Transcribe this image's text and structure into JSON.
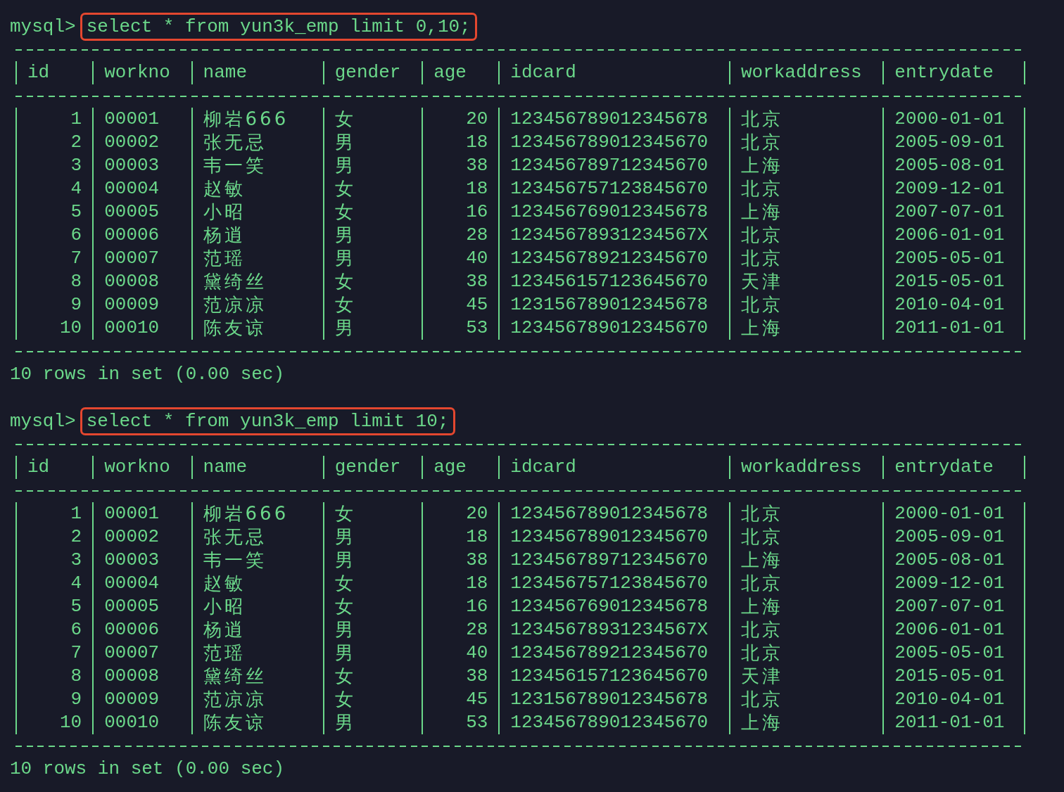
{
  "queries": [
    {
      "prompt": "mysql>",
      "command": "select * from yun3k_emp limit 0,10;",
      "highlighted": true,
      "columns": [
        "id",
        "workno",
        "name",
        "gender",
        "age",
        "idcard",
        "workaddress",
        "entrydate"
      ],
      "rows": [
        [
          "1",
          "00001",
          "柳岩666",
          "女",
          "20",
          "123456789012345678",
          "北京",
          "2000-01-01"
        ],
        [
          "2",
          "00002",
          "张无忌",
          "男",
          "18",
          "123456789012345670",
          "北京",
          "2005-09-01"
        ],
        [
          "3",
          "00003",
          "韦一笑",
          "男",
          "38",
          "123456789712345670",
          "上海",
          "2005-08-01"
        ],
        [
          "4",
          "00004",
          "赵敏",
          "女",
          "18",
          "123456757123845670",
          "北京",
          "2009-12-01"
        ],
        [
          "5",
          "00005",
          "小昭",
          "女",
          "16",
          "123456769012345678",
          "上海",
          "2007-07-01"
        ],
        [
          "6",
          "00006",
          "杨逍",
          "男",
          "28",
          "12345678931234567X",
          "北京",
          "2006-01-01"
        ],
        [
          "7",
          "00007",
          "范瑶",
          "男",
          "40",
          "123456789212345670",
          "北京",
          "2005-05-01"
        ],
        [
          "8",
          "00008",
          "黛绮丝",
          "女",
          "38",
          "123456157123645670",
          "天津",
          "2015-05-01"
        ],
        [
          "9",
          "00009",
          "范凉凉",
          "女",
          "45",
          "123156789012345678",
          "北京",
          "2010-04-01"
        ],
        [
          "10",
          "00010",
          "陈友谅",
          "男",
          "53",
          "123456789012345670",
          "上海",
          "2011-01-01"
        ]
      ],
      "summary": "10 rows in set (0.00 sec)"
    },
    {
      "prompt": "mysql>",
      "command": "select * from yun3k_emp limit 10;",
      "highlighted": true,
      "columns": [
        "id",
        "workno",
        "name",
        "gender",
        "age",
        "idcard",
        "workaddress",
        "entrydate"
      ],
      "rows": [
        [
          "1",
          "00001",
          "柳岩666",
          "女",
          "20",
          "123456789012345678",
          "北京",
          "2000-01-01"
        ],
        [
          "2",
          "00002",
          "张无忌",
          "男",
          "18",
          "123456789012345670",
          "北京",
          "2005-09-01"
        ],
        [
          "3",
          "00003",
          "韦一笑",
          "男",
          "38",
          "123456789712345670",
          "上海",
          "2005-08-01"
        ],
        [
          "4",
          "00004",
          "赵敏",
          "女",
          "18",
          "123456757123845670",
          "北京",
          "2009-12-01"
        ],
        [
          "5",
          "00005",
          "小昭",
          "女",
          "16",
          "123456769012345678",
          "上海",
          "2007-07-01"
        ],
        [
          "6",
          "00006",
          "杨逍",
          "男",
          "28",
          "12345678931234567X",
          "北京",
          "2006-01-01"
        ],
        [
          "7",
          "00007",
          "范瑶",
          "男",
          "40",
          "123456789212345670",
          "北京",
          "2005-05-01"
        ],
        [
          "8",
          "00008",
          "黛绮丝",
          "女",
          "38",
          "123456157123645670",
          "天津",
          "2015-05-01"
        ],
        [
          "9",
          "00009",
          "范凉凉",
          "女",
          "45",
          "123156789012345678",
          "北京",
          "2010-04-01"
        ],
        [
          "10",
          "00010",
          "陈友谅",
          "男",
          "53",
          "123456789012345670",
          "上海",
          "2011-01-01"
        ]
      ],
      "summary": "10 rows in set (0.00 sec)"
    }
  ]
}
